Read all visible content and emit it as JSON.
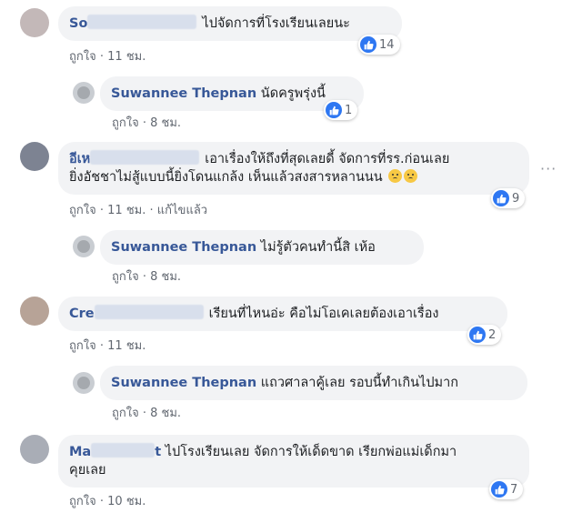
{
  "comments": [
    {
      "name_visible": "So",
      "text": "ไปจัดการที่โรงเรียนเลยนะ",
      "like_label": "ถูกใจ",
      "time": "11 ชม.",
      "reactions": "14",
      "edited": ""
    },
    {
      "name_visible": "Suwannee Thepnan",
      "text": "นัดครูพรุ่งนี้",
      "like_label": "ถูกใจ",
      "time": "8 ชม.",
      "reactions": "1"
    },
    {
      "name_visible": "อีเห",
      "text_line1": "เอาเรื่องให้ถึงที่สุดเลยดี้ จัดการที่รร.ก่อนเลย",
      "text_line2": "ยิ่งอัชชาไม่สู้แบบนี้ยิ่งโดนแกล้ง เห็นแล้วสงสารหลานนน",
      "like_label": "ถูกใจ",
      "time": "11 ชม.",
      "edited": "แก้ไขแล้ว",
      "reactions": "9"
    },
    {
      "name_visible": "Suwannee Thepnan",
      "text": "ไม่รู้ตัวคนทำนี้สิ เห้อ",
      "like_label": "ถูกใจ",
      "time": "8 ชม."
    },
    {
      "name_visible": "Cre",
      "text": "เรียนที่ไหนอ่ะ คือไม่โอเคเลยต้องเอาเรื่อง",
      "like_label": "ถูกใจ",
      "time": "11 ชม.",
      "reactions": "2"
    },
    {
      "name_visible": "Suwannee Thepnan",
      "text": "แถวศาลาคู้เลย รอบนี้ทำเกินไปมาก",
      "like_label": "ถูกใจ",
      "time": "8 ชม."
    },
    {
      "name_visible": "Ma",
      "name_tail": "t",
      "text_line1": "ไปโรงเรียนเลย จัดการให้เด็ดขาด เรียกพ่อแม่เด็กมา",
      "text_line2": "คุยเลย",
      "like_label": "ถูกใจ",
      "time": "10 ชม.",
      "reactions": "7"
    }
  ],
  "separator": "·",
  "more_label": "···",
  "colors": {
    "name": "#385898",
    "bubble": "#f2f3f5",
    "like": "#2e77f2"
  }
}
